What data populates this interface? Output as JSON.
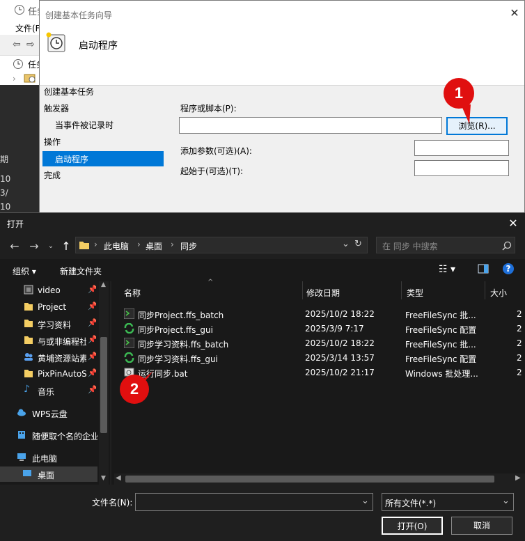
{
  "background_app": {
    "title": "任务",
    "menu_file": "文件(F",
    "tree_label": "任务",
    "column_fragments": [
      "期",
      "10",
      "3/",
      "10"
    ]
  },
  "wizard": {
    "title": "创建基本任务向导",
    "heading": "启动程序",
    "steps": [
      "创建基本任务",
      "触发器",
      "当事件被记录时",
      "操作",
      "启动程序",
      "完成"
    ],
    "active_step": "启动程序",
    "program_label": "程序或脚本(P):",
    "program_value": "",
    "browse_button": "浏览(R)...",
    "args_label": "添加参数(可选)(A):",
    "start_in_label": "起始于(可选)(T):"
  },
  "badges": [
    "1",
    "2"
  ],
  "open_dialog": {
    "title": "打开",
    "breadcrumb": [
      "此电脑",
      "桌面",
      "同步"
    ],
    "search_placeholder": "在 同步 中搜索",
    "toolbar": {
      "organize": "组织",
      "new_folder": "新建文件夹"
    },
    "sidebar": [
      {
        "label": "video",
        "icon": "video-folder-icon",
        "pinned": true
      },
      {
        "label": "Project",
        "icon": "folder-icon",
        "pinned": true
      },
      {
        "label": "学习资料",
        "icon": "folder-icon",
        "pinned": true
      },
      {
        "label": "与或非编程社",
        "icon": "folder-icon",
        "pinned": true
      },
      {
        "label": "黄埔资源站素",
        "icon": "people-folder-icon",
        "pinned": true
      },
      {
        "label": "PixPinAutoSa",
        "icon": "folder-icon",
        "pinned": true
      },
      {
        "label": "音乐",
        "icon": "music-icon",
        "pinned": true
      },
      {
        "label": "WPS云盘",
        "icon": "cloud-icon",
        "pinned": false
      },
      {
        "label": "随便取个名的企业",
        "icon": "enterprise-icon",
        "pinned": false
      },
      {
        "label": "此电脑",
        "icon": "computer-icon",
        "pinned": false
      },
      {
        "label": "桌面",
        "icon": "desktop-icon",
        "pinned": false
      }
    ],
    "columns": [
      "名称",
      "修改日期",
      "类型",
      "大小"
    ],
    "files": [
      {
        "name": "同步Project.ffs_batch",
        "date": "2025/10/2 18:22",
        "type": "FreeFileSync 批...",
        "size": "2",
        "icon": "batch-icon"
      },
      {
        "name": "同步Project.ffs_gui",
        "date": "2025/3/9 7:17",
        "type": "FreeFileSync 配置",
        "size": "2",
        "icon": "sync-icon"
      },
      {
        "name": "同步学习资料.ffs_batch",
        "date": "2025/10/2 18:22",
        "type": "FreeFileSync 批...",
        "size": "2",
        "icon": "batch-icon"
      },
      {
        "name": "同步学习资料.ffs_gui",
        "date": "2025/3/14 13:57",
        "type": "FreeFileSync 配置",
        "size": "2",
        "icon": "sync-icon"
      },
      {
        "name": "运行同步.bat",
        "date": "2025/10/2 21:17",
        "type": "Windows 批处理...",
        "size": "2",
        "icon": "bat-file-icon"
      }
    ],
    "filename_label": "文件名(N):",
    "filename_value": "",
    "filetype": "所有文件(*.*)",
    "open_button": "打开(O)",
    "cancel_button": "取消"
  },
  "colors": {
    "accent": "#0078d7",
    "badge": "#e00f0f",
    "dark_bg": "#191919"
  }
}
